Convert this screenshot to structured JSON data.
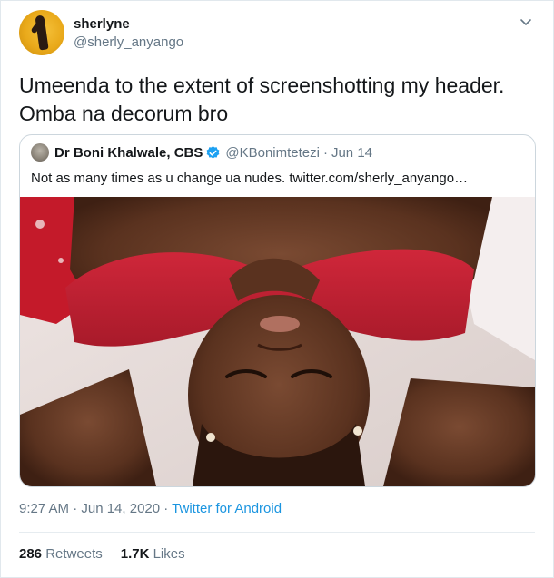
{
  "author": {
    "display_name": "sherlyne",
    "handle": "@sherly_anyango",
    "avatar_icon": "profile-photo-icon"
  },
  "tweet_text_line1": "Umeenda to the extent of screenshotting my header.",
  "tweet_text_line2": "Omba na decorum bro",
  "quoted": {
    "display_name": "Dr Boni Khalwale, CBS",
    "verified_icon": "verified-badge-icon",
    "handle": "@KBonimtetezi",
    "separator": "·",
    "date": "Jun 14",
    "text": "Not as many times as u change ua nudes.  twitter.com/sherly_anyango…",
    "media_icon": "photo-image-icon"
  },
  "meta": {
    "time": "9:27 AM · Jun 14, 2020 · ",
    "source": "Twitter for Android"
  },
  "stats": {
    "retweets_count": "286",
    "retweets_label": "Retweets",
    "likes_count": "1.7K",
    "likes_label": "Likes"
  },
  "colors": {
    "link_blue": "#1b95e0",
    "secondary_text": "#657786",
    "primary_text": "#14171a",
    "border": "#ccd6dd"
  }
}
